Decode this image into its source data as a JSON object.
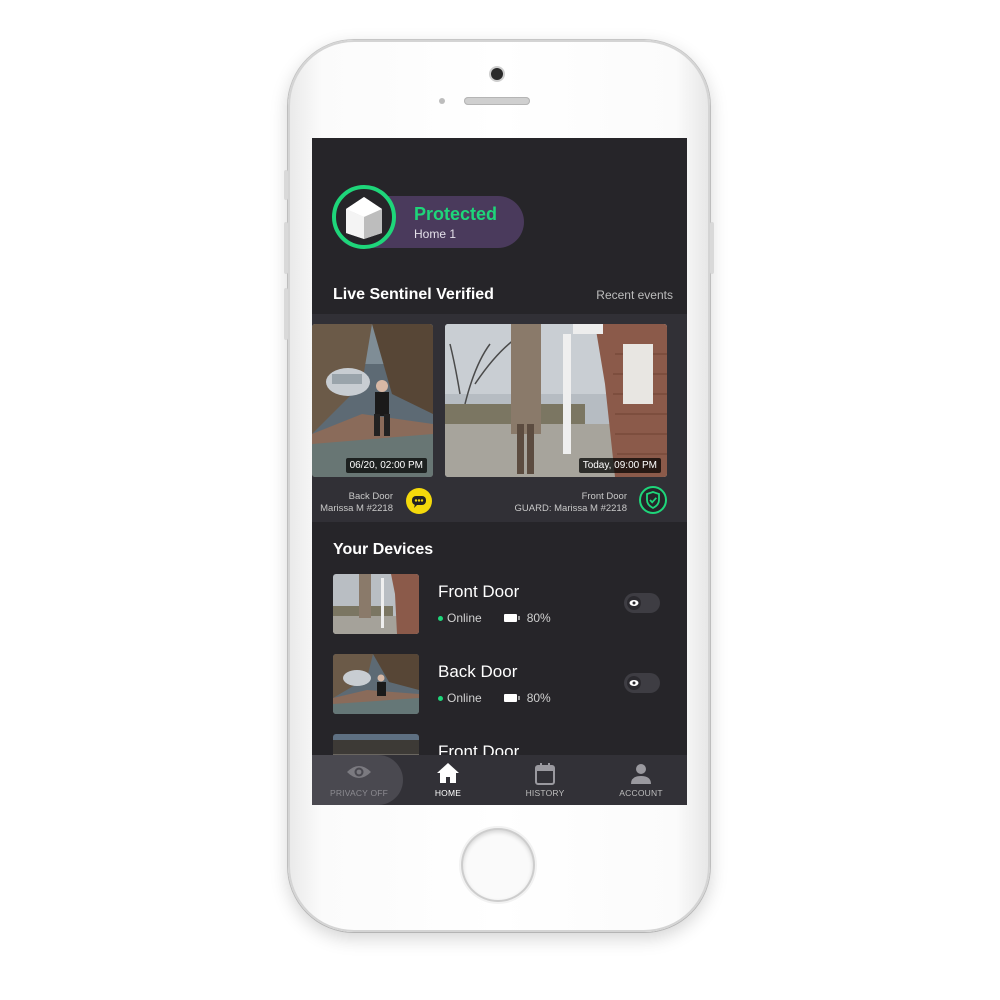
{
  "status": {
    "title": "Protected",
    "home": "Home 1",
    "accent": "#1ed67a"
  },
  "live": {
    "title": "Live Sentinel Verified",
    "recent_link": "Recent events",
    "events": [
      {
        "timestamp": "06/20, 02:00 PM",
        "location": "Back Door",
        "agent": "Marissa M #2218",
        "icon": "chat-icon",
        "icon_color": "#f4d90b"
      },
      {
        "timestamp": "Today, 09:00 PM",
        "location": "Front Door",
        "agent": "GUARD: Marissa M #2218",
        "icon": "shield-check-icon",
        "icon_color": "#1ed67a"
      }
    ]
  },
  "devices": {
    "title": "Your Devices",
    "items": [
      {
        "name": "Front Door",
        "status": "Online",
        "battery": "80%"
      },
      {
        "name": "Back Door",
        "status": "Online",
        "battery": "80%"
      },
      {
        "name": "Front Door"
      }
    ]
  },
  "tabbar": {
    "privacy": "PRIVACY OFF",
    "home": "HOME",
    "history": "HISTORY",
    "account": "ACCOUNT"
  }
}
